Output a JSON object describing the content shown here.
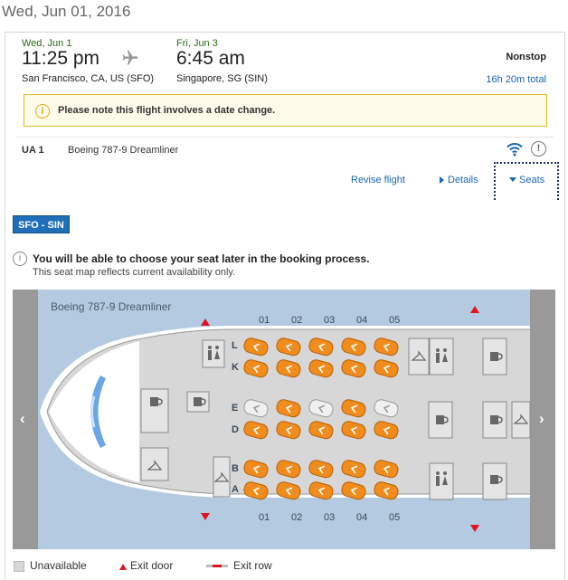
{
  "header": {
    "date": "Wed, Jun 01, 2016"
  },
  "flight": {
    "departure": {
      "date": "Wed, Jun 1",
      "time": "11:25 pm",
      "city": "San Francisco, CA, US (SFO)"
    },
    "arrival": {
      "date": "Fri, Jun 3",
      "time": "6:45 am",
      "city": "Singapore, SG (SIN)"
    },
    "stops": "Nonstop",
    "duration": "16h 20m total",
    "notice": "Please note this flight involves a date change.",
    "flight_number": "UA 1",
    "aircraft": "Boeing 787-9 Dreamliner",
    "links": {
      "revise": "Revise flight",
      "details": "Details",
      "seats": "Seats"
    }
  },
  "seatmap": {
    "route_tab": "SFO - SIN",
    "info_bold": "You will be able to choose your seat later in the booking process.",
    "info_sub": "This seat map reflects current availability only.",
    "aircraft_label": "Boeing 787-9 Dreamliner",
    "columns": [
      "01",
      "02",
      "03",
      "04",
      "05"
    ],
    "rows": [
      "L",
      "K",
      "E",
      "D",
      "B",
      "A"
    ],
    "availability": {
      "L": [
        "available",
        "available",
        "available",
        "available",
        "available"
      ],
      "K": [
        "available",
        "available",
        "available",
        "available",
        "available"
      ],
      "E": [
        "unavailable",
        "available",
        "unavailable",
        "available",
        "unavailable"
      ],
      "D": [
        "available",
        "available",
        "available",
        "available",
        "available"
      ],
      "B": [
        "available",
        "available",
        "available",
        "available",
        "available"
      ],
      "A": [
        "available",
        "available",
        "available",
        "available",
        "available"
      ]
    },
    "nav": {
      "prev": "‹",
      "next": "›"
    },
    "colors": {
      "available": "#f08c1e",
      "unavailable": "#d7d7d7",
      "exit": "#e0141e",
      "water": "#b3cae0"
    }
  },
  "legend": {
    "unavailable": "Unavailable",
    "exit_door": "Exit door",
    "exit_row": "Exit row"
  }
}
